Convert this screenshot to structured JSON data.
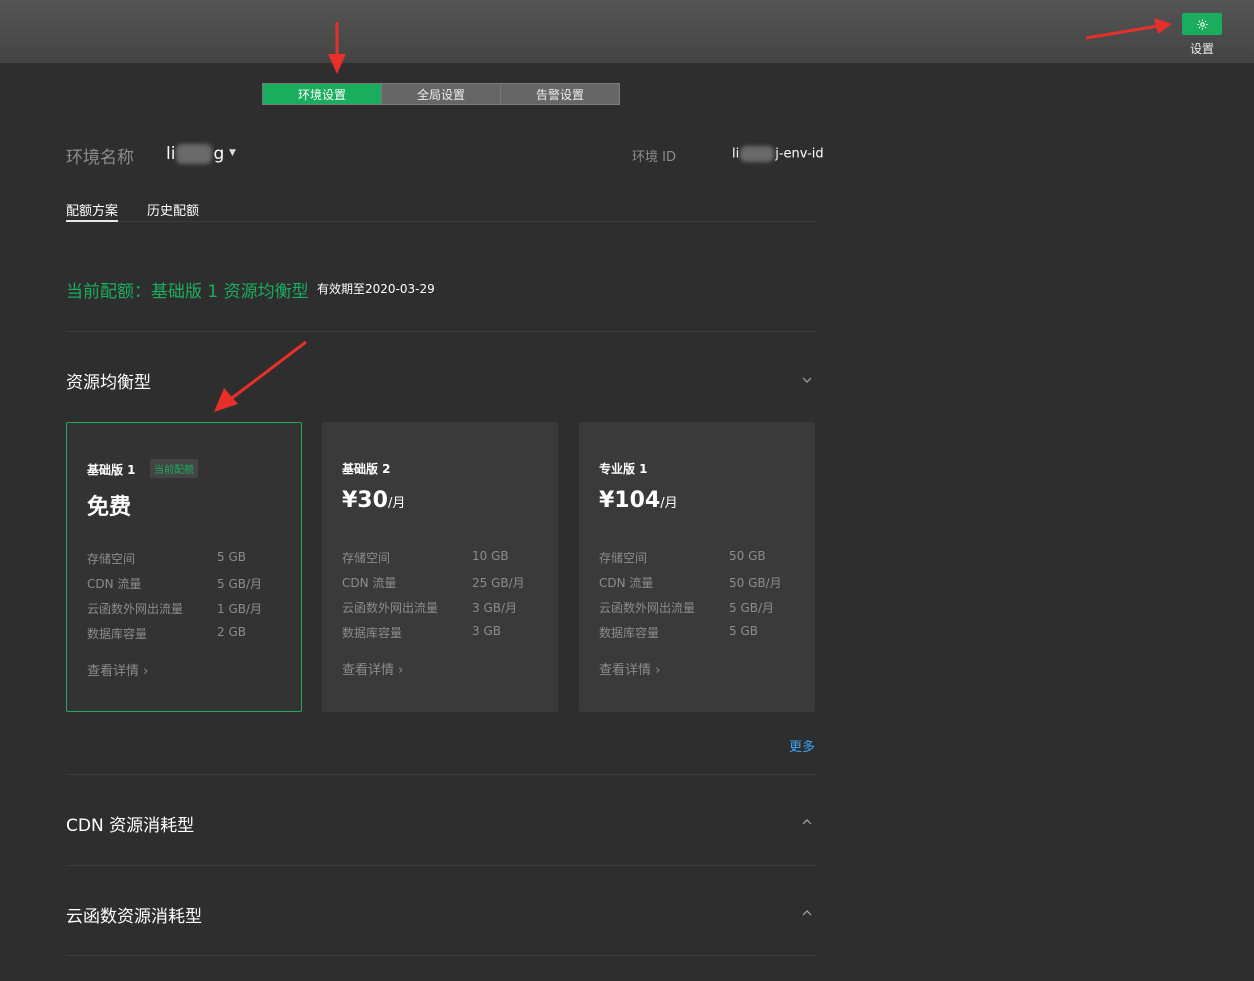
{
  "topbar": {
    "settings_label": "设置"
  },
  "tabs": [
    {
      "label": "环境设置",
      "active": true
    },
    {
      "label": "全局设置",
      "active": false
    },
    {
      "label": "告警设置",
      "active": false
    }
  ],
  "env": {
    "name_label": "环境名称",
    "name_prefix": "li",
    "name_suffix": "g",
    "id_label": "环境 ID",
    "id_prefix": "li",
    "id_suffix": "j-env-id"
  },
  "subtabs": [
    {
      "label": "配额方案",
      "active": true
    },
    {
      "label": "历史配额",
      "active": false
    }
  ],
  "current": {
    "text": "当前配额：基础版 1 资源均衡型",
    "valid_until": "有效期至2020-03-29"
  },
  "sections": {
    "balanced": "资源均衡型",
    "cdn": "CDN 资源消耗型",
    "functions": "云函数资源消耗型"
  },
  "spec_labels": [
    "存储空间",
    "CDN 流量",
    "云函数外网出流量",
    "数据库容量"
  ],
  "cards": [
    {
      "name": "基础版 1",
      "badge": "当前配额",
      "price": "免费",
      "unit": "",
      "specs": [
        "5 GB",
        "5 GB/月",
        "1 GB/月",
        "2 GB"
      ],
      "detail": "查看详情 ›"
    },
    {
      "name": "基础版 2",
      "badge": "",
      "price": "¥30",
      "unit": "/月",
      "specs": [
        "10 GB",
        "25 GB/月",
        "3 GB/月",
        "3 GB"
      ],
      "detail": "查看详情 ›"
    },
    {
      "name": "专业版 1",
      "badge": "",
      "price": "¥104",
      "unit": "/月",
      "specs": [
        "50 GB",
        "50 GB/月",
        "5 GB/月",
        "5 GB"
      ],
      "detail": "查看详情 ›"
    }
  ],
  "more_label": "更多",
  "colors": {
    "accent": "#1aad5e",
    "link": "#3ba5f5",
    "annotation": "#e8302a"
  },
  "icons": {
    "settings": "gear-icon",
    "collapse": "chevron-down-icon",
    "expand": "chevron-up-icon",
    "caret": "caret-down-icon"
  }
}
